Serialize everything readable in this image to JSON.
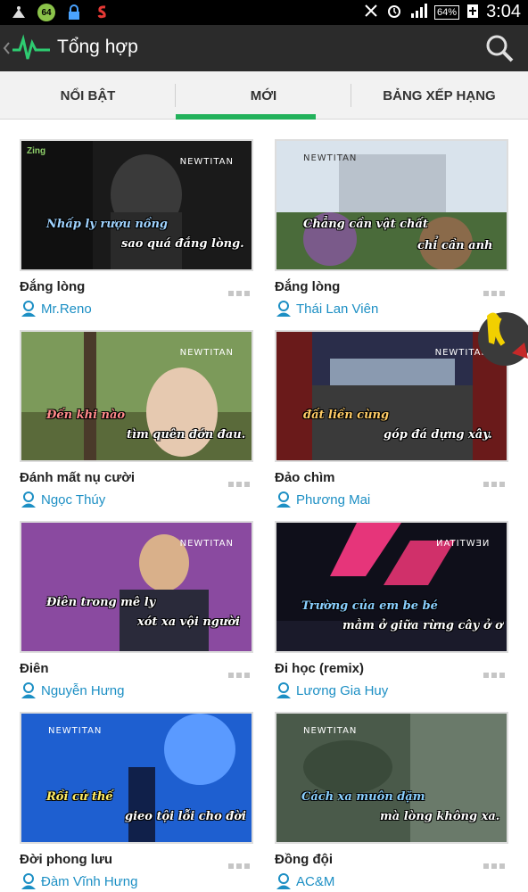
{
  "status_bar": {
    "badge": "64",
    "battery": "64%",
    "time": "3:04"
  },
  "header": {
    "title": "Tổng hợp"
  },
  "tabs": [
    {
      "label": "NỔI BẬT"
    },
    {
      "label": "MỚI"
    },
    {
      "label": "BẢNG XẾP HẠNG"
    }
  ],
  "songs": [
    {
      "title": "Đắng lòng",
      "artist": "Mr.Reno",
      "cap1": "Nhấp ly rượu nồng",
      "cap2": "sao quá đắng lòng.",
      "logo": "NEWTITAN",
      "brand": "Zing"
    },
    {
      "title": "Đắng lòng",
      "artist": "Thái Lan Viên",
      "cap1": "Chẳng cần vật chất",
      "cap2": "chỉ cần anh",
      "logo": "NEWTITAN"
    },
    {
      "title": "Đánh mất nụ cười",
      "artist": "Ngọc Thúy",
      "cap1": "Đến khi nào",
      "cap2": "tìm quên đớn đau.",
      "logo": "NEWTITAN"
    },
    {
      "title": "Đảo chìm",
      "artist": "Phương Mai",
      "cap1": "đất liền cùng",
      "cap2": "góp đá dựng xây.",
      "logo": "NEWTITAN"
    },
    {
      "title": "Điên",
      "artist": "Nguyễn Hưng",
      "cap1": "Điên trong mê ly",
      "cap2": "xót xa vội người",
      "logo": "NEWTITAN"
    },
    {
      "title": "Đi học (remix)",
      "artist": "Lương Gia Huy",
      "cap1": "Trường của em be bé",
      "cap2": "mằm ở giữa rừng cây ở ơ",
      "logo": "NEWTITAN"
    },
    {
      "title": "Đời phong lưu",
      "artist": "Đàm Vĩnh Hưng",
      "cap1": "Rồi cứ thế",
      "cap2": "gieo tội lỗi cho đời",
      "logo": "NEWTITAN"
    },
    {
      "title": "Đồng đội",
      "artist": "AC&M",
      "cap1": "Cách xa muôn dặm",
      "cap2": "mà lòng không xa.",
      "logo": "NEWTITAN"
    }
  ],
  "colors": {
    "accent": "#22b25b",
    "artist": "#1c8fc4",
    "actionbar": "#2b2b2b"
  }
}
